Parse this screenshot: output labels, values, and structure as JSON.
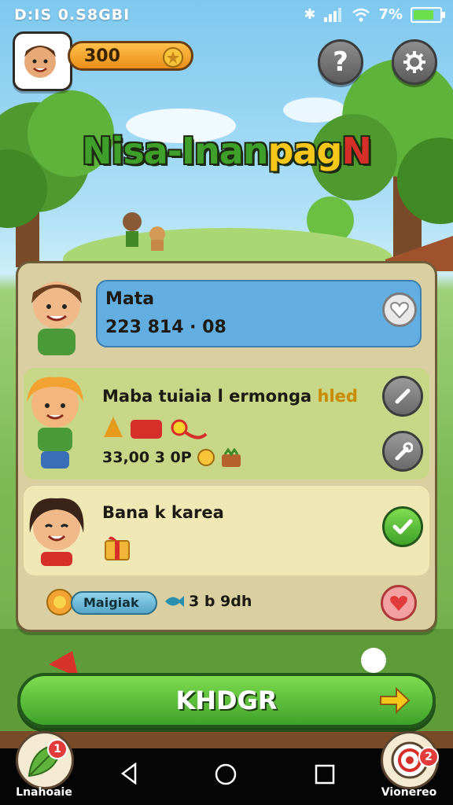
{
  "status_bar": {
    "time": "D:IS 0.S8GBI",
    "battery_text": "7%",
    "battery_level": 0.7
  },
  "hud": {
    "coins": "300",
    "help_label": "?"
  },
  "title": {
    "part1": "Nisa-Inan",
    "part2": "pag",
    "part3": "N"
  },
  "cards": [
    {
      "name": "Mata",
      "value": "223 814 · 08"
    },
    {
      "name": "Maba tuiaia l ermonga",
      "name_suffix": "hled",
      "stats": "33,00 3 0P"
    },
    {
      "name": "Bana k karea"
    }
  ],
  "footer": {
    "pill_label": "Maigiak",
    "info_text": "3 b 9dh"
  },
  "action_button": {
    "label": "KHDGR"
  },
  "corner_left": {
    "label": "Lnahoaie",
    "badge": "1"
  },
  "corner_right": {
    "label": "Vionereo",
    "badge": "2"
  },
  "colors": {
    "accent_green": "#3fa22a",
    "coin_orange": "#e98f1a",
    "card_blue": "#62aee0"
  },
  "icons": [
    "bluetooth-icon",
    "signal-icon",
    "wifi-icon",
    "battery-icon",
    "star-coin-icon",
    "gear-icon",
    "heart-icon",
    "brush-icon",
    "wrench-icon",
    "check-icon",
    "arrow-right-icon",
    "back-icon",
    "home-icon",
    "recents-icon"
  ]
}
